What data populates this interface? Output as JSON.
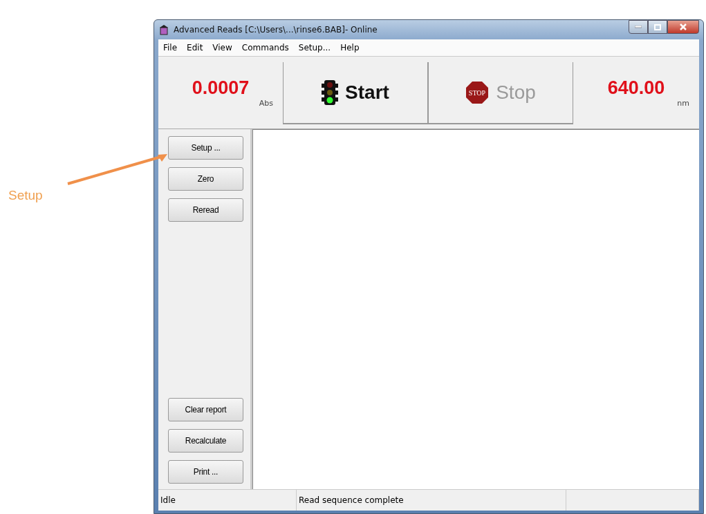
{
  "annotation": {
    "label": "Setup"
  },
  "window": {
    "title": "Advanced Reads [C:\\Users\\...\\rinse6.BAB]- Online"
  },
  "menu": [
    "File",
    "Edit",
    "View",
    "Commands",
    "Setup...",
    "Help"
  ],
  "toolbar": {
    "absorbance": {
      "value": "0.0007",
      "unit": "Abs"
    },
    "buttons": [
      {
        "kind": "start",
        "label": "Start",
        "disabled": false
      },
      {
        "kind": "stop",
        "label": "Stop",
        "disabled": true,
        "icon_text": "STOP"
      }
    ],
    "wavelength": {
      "value": "640.00",
      "unit": "nm"
    }
  },
  "side_buttons_top": [
    "Setup ...",
    "Zero",
    "Reread"
  ],
  "side_buttons_bottom": [
    "Clear report",
    "Recalculate",
    "Print ..."
  ],
  "status_bar": [
    "Idle",
    "Read sequence complete"
  ]
}
